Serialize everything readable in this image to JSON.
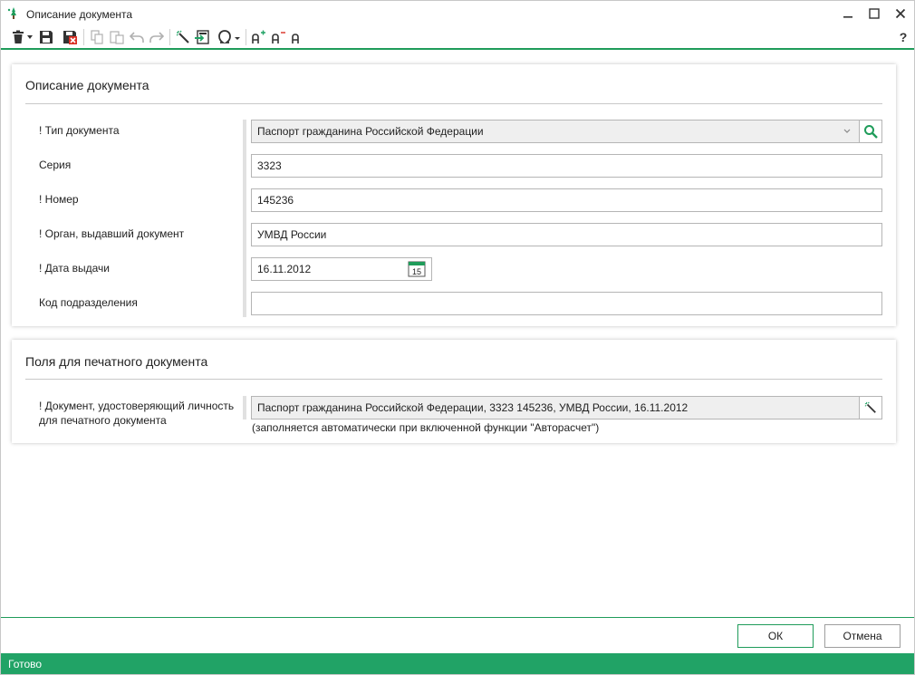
{
  "window": {
    "title": "Описание документа"
  },
  "colors": {
    "accent": "#21a366",
    "border": "#b5b5b5"
  },
  "toolbar": {
    "icons": [
      "delete-icon",
      "dropdown-arrow-icon",
      "save-icon",
      "save-close-icon",
      "copy-icon",
      "paste-icon",
      "undo-icon",
      "redo-icon",
      "magic-wand-icon",
      "import-icon",
      "omega-symbol-icon",
      "font-increase-icon",
      "font-decrease-icon",
      "font-normal-icon",
      "help-icon"
    ],
    "help_label": "?"
  },
  "section_document": {
    "title": "Описание документа",
    "fields": {
      "doc_type": {
        "label": "! Тип документа",
        "value": "Паспорт гражданина Российской Федерации"
      },
      "series": {
        "label": "Серия",
        "value": "3323"
      },
      "number": {
        "label": "! Номер",
        "value": "145236"
      },
      "issuer": {
        "label": "! Орган, выдавший документ",
        "value": "УМВД России"
      },
      "issue_date": {
        "label": "! Дата выдачи",
        "value": "16.11.2012",
        "calendar_day": "15"
      },
      "division_code": {
        "label": "Код подразделения",
        "value": ""
      }
    }
  },
  "section_print": {
    "title": "Поля для печатного документа",
    "field": {
      "label_line1": "! Документ, удостоверяющий личность",
      "label_line2": "для печатного документа",
      "value": "Паспорт гражданина Российской Федерации, 3323 145236, УМВД России, 16.11.2012",
      "hint": "(заполняется автоматически при включенной функции \"Авторасчет\")"
    }
  },
  "footer": {
    "ok_label": "ОК",
    "cancel_label": "Отмена"
  },
  "status": {
    "text": "Готово"
  }
}
